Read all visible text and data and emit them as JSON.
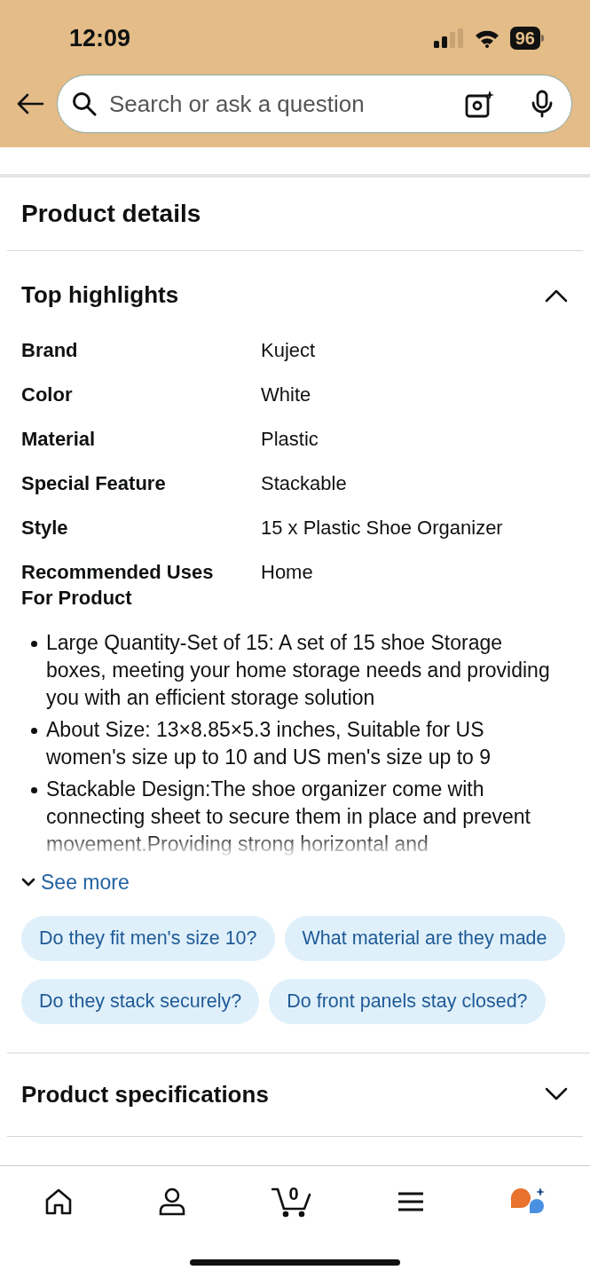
{
  "status_bar": {
    "time": "12:09",
    "battery": "96"
  },
  "search": {
    "placeholder": "Search or ask a question"
  },
  "section": {
    "title": "Product details"
  },
  "highlights": {
    "title": "Top highlights",
    "expanded": true,
    "rows": [
      {
        "label": "Brand",
        "value": "Kuject"
      },
      {
        "label": "Color",
        "value": "White"
      },
      {
        "label": "Material",
        "value": "Plastic"
      },
      {
        "label": "Special Feature",
        "value": "Stackable"
      },
      {
        "label": "Style",
        "value": "15 x Plastic Shoe Organizer"
      },
      {
        "label": "Recommended Uses For Product",
        "value": "Home"
      }
    ],
    "bullets": [
      "Large Quantity-Set of 15: A set of 15 shoe Storage boxes, meeting your home storage needs and providing you with an efficient storage solution",
      "About Size: 13×8.85×5.3 inches, Suitable for US women's size up to 10 and US men's size up to 9",
      "Stackable Design:The shoe organizer come with connecting sheet to secure them in place and prevent movement.Providing strong horizontal and"
    ],
    "see_more": "See more"
  },
  "questions": [
    [
      "Do they fit men's size 10?",
      "What material are they made"
    ],
    [
      "Do they stack securely?",
      "Do front panels stay closed?"
    ]
  ],
  "specifications": {
    "title": "Product specifications",
    "expanded": false
  },
  "nav": {
    "cart_count": "0"
  }
}
